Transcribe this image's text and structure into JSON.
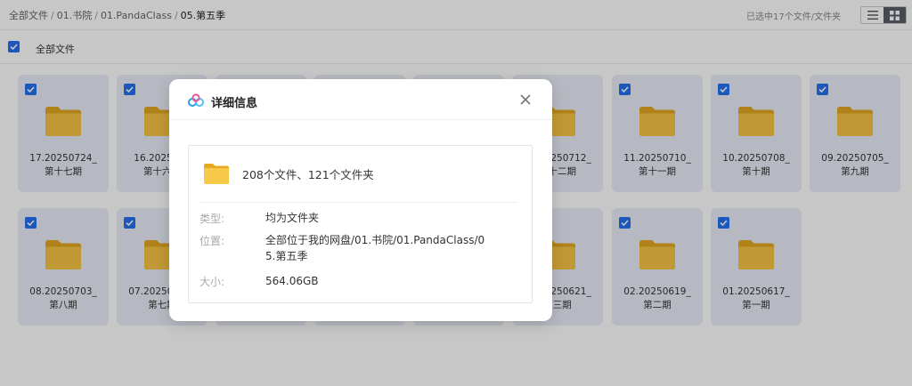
{
  "breadcrumb": {
    "items": [
      "全部文件",
      "01.书院",
      "01.PandaClass"
    ],
    "current": "05.第五季",
    "separator": "/"
  },
  "selection_info": "已选中17个文件/文件夹",
  "view_toggle": {
    "list_icon": "list-icon",
    "grid_icon": "grid-icon",
    "active": "grid"
  },
  "select_all": {
    "label": "全部文件",
    "checked": true
  },
  "folders": [
    {
      "line1": "17.20250724_",
      "line2": "第十七期"
    },
    {
      "line1": "16.2025072",
      "line2": "第十六期"
    },
    {
      "line1": "",
      "line2": ""
    },
    {
      "line1": "",
      "line2": ""
    },
    {
      "line1": "",
      "line2": ""
    },
    {
      "line1": "12.20250712_",
      "line2": "第十二期"
    },
    {
      "line1": "11.20250710_",
      "line2": "第十一期"
    },
    {
      "line1": "10.20250708_",
      "line2": "第十期"
    },
    {
      "line1": "09.20250705_",
      "line2": "第九期"
    },
    {
      "line1": "08.20250703_",
      "line2": "第八期"
    },
    {
      "line1": "07.20250701_",
      "line2": "第七期"
    },
    {
      "line1": "",
      "line2": ""
    },
    {
      "line1": "",
      "line2": ""
    },
    {
      "line1": "",
      "line2": ""
    },
    {
      "line1": "03.20250621_",
      "line2": "第三期"
    },
    {
      "line1": "02.20250619_",
      "line2": "第二期"
    },
    {
      "line1": "01.20250617_",
      "line2": "第一期"
    }
  ],
  "dialog": {
    "title": "详细信息",
    "summary": "208个文件、121个文件夹",
    "type_label": "类型:",
    "type_value": "均为文件夹",
    "location_label": "位置:",
    "location_value_line1": "全部位于我的网盘/01.书院/01.PandaClass/0",
    "location_value_line2": "5.第五季",
    "size_label": "大小:",
    "size_value": "564.06GB"
  },
  "colors": {
    "accent": "#2470f0",
    "folder": "#f5c242",
    "card_bg": "#eaeef8"
  }
}
